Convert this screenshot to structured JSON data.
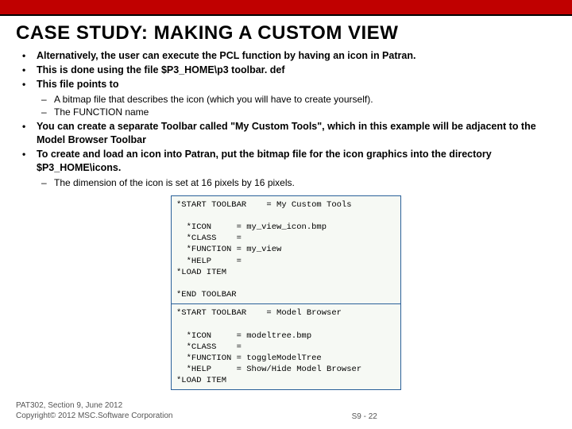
{
  "header": {
    "title": "CASE STUDY: MAKING A CUSTOM VIEW"
  },
  "bullets": {
    "b1": "Alternatively, the user can execute the PCL function by having an icon in Patran.",
    "b2": "This is done using the file $P3_HOME\\p3 toolbar. def",
    "b3": "This file points to",
    "b3s1": "A bitmap file that describes the icon (which you will have to create yourself).",
    "b3s2": "The FUNCTION name",
    "b4": "You can create a separate Toolbar called \"My Custom Tools\", which in this example will be adjacent to the Model Browser Toolbar",
    "b5": "To create and load an icon into Patran, put the bitmap file for the icon graphics into the directory $P3_HOME\\icons.",
    "b5s1": "The dimension of the icon is set at 16 pixels by 16 pixels."
  },
  "code": {
    "l1": "*START TOOLBAR    = My Custom Tools",
    "l2": "",
    "l3": "  *ICON     = my_view_icon.bmp",
    "l4": "  *CLASS    =",
    "l5": "  *FUNCTION = my_view",
    "l6": "  *HELP     =",
    "l7": "*LOAD ITEM",
    "l8": "",
    "l9": "*END TOOLBAR",
    "l10": "*START TOOLBAR    = Model Browser",
    "l11": "",
    "l12": "  *ICON     = modeltree.bmp",
    "l13": "  *CLASS    =",
    "l14": "  *FUNCTION = toggleModelTree",
    "l15": "  *HELP     = Show/Hide Model Browser",
    "l16": "*LOAD ITEM"
  },
  "footer": {
    "line1": "PAT302, Section 9, June 2012",
    "line2": "Copyright© 2012 MSC.Software Corporation",
    "page": "S9 - 22"
  }
}
